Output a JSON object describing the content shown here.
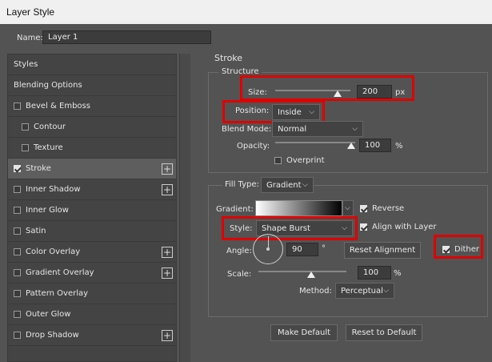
{
  "window": {
    "title": "Layer Style"
  },
  "name": {
    "label": "Name:",
    "value": "Layer 1"
  },
  "sidebar": {
    "items": [
      {
        "label": "Styles"
      },
      {
        "label": "Blending Options"
      },
      {
        "label": "Bevel & Emboss"
      },
      {
        "label": "Contour"
      },
      {
        "label": "Texture"
      },
      {
        "label": "Stroke"
      },
      {
        "label": "Inner Shadow"
      },
      {
        "label": "Inner Glow"
      },
      {
        "label": "Satin"
      },
      {
        "label": "Color Overlay"
      },
      {
        "label": "Gradient Overlay"
      },
      {
        "label": "Pattern Overlay"
      },
      {
        "label": "Outer Glow"
      },
      {
        "label": "Drop Shadow"
      }
    ],
    "plus_symbol": "+"
  },
  "stroke": {
    "title": "Stroke",
    "structure": {
      "title": "Structure",
      "size_label": "Size:",
      "size_value": "200",
      "size_unit": "px",
      "position_label": "Position:",
      "position_value": "Inside",
      "blend_label": "Blend Mode:",
      "blend_value": "Normal",
      "opacity_label": "Opacity:",
      "opacity_value": "100",
      "opacity_unit": "%",
      "overprint_label": "Overprint"
    },
    "fill": {
      "type_label": "Fill Type:",
      "type_value": "Gradient",
      "gradient_label": "Gradient:",
      "reverse_label": "Reverse",
      "style_label": "Style:",
      "style_value": "Shape Burst",
      "align_label": "Align with Layer",
      "dither_label": "Dither",
      "angle_label": "Angle:",
      "angle_value": "90",
      "angle_unit": "°",
      "reset_alignment": "Reset Alignment",
      "scale_label": "Scale:",
      "scale_value": "100",
      "scale_unit": "%",
      "method_label": "Method:",
      "method_value": "Perceptual"
    },
    "make_default": "Make Default",
    "reset_default": "Reset to Default"
  },
  "colors": {
    "highlight": "#e00000",
    "panel": "#535353"
  }
}
